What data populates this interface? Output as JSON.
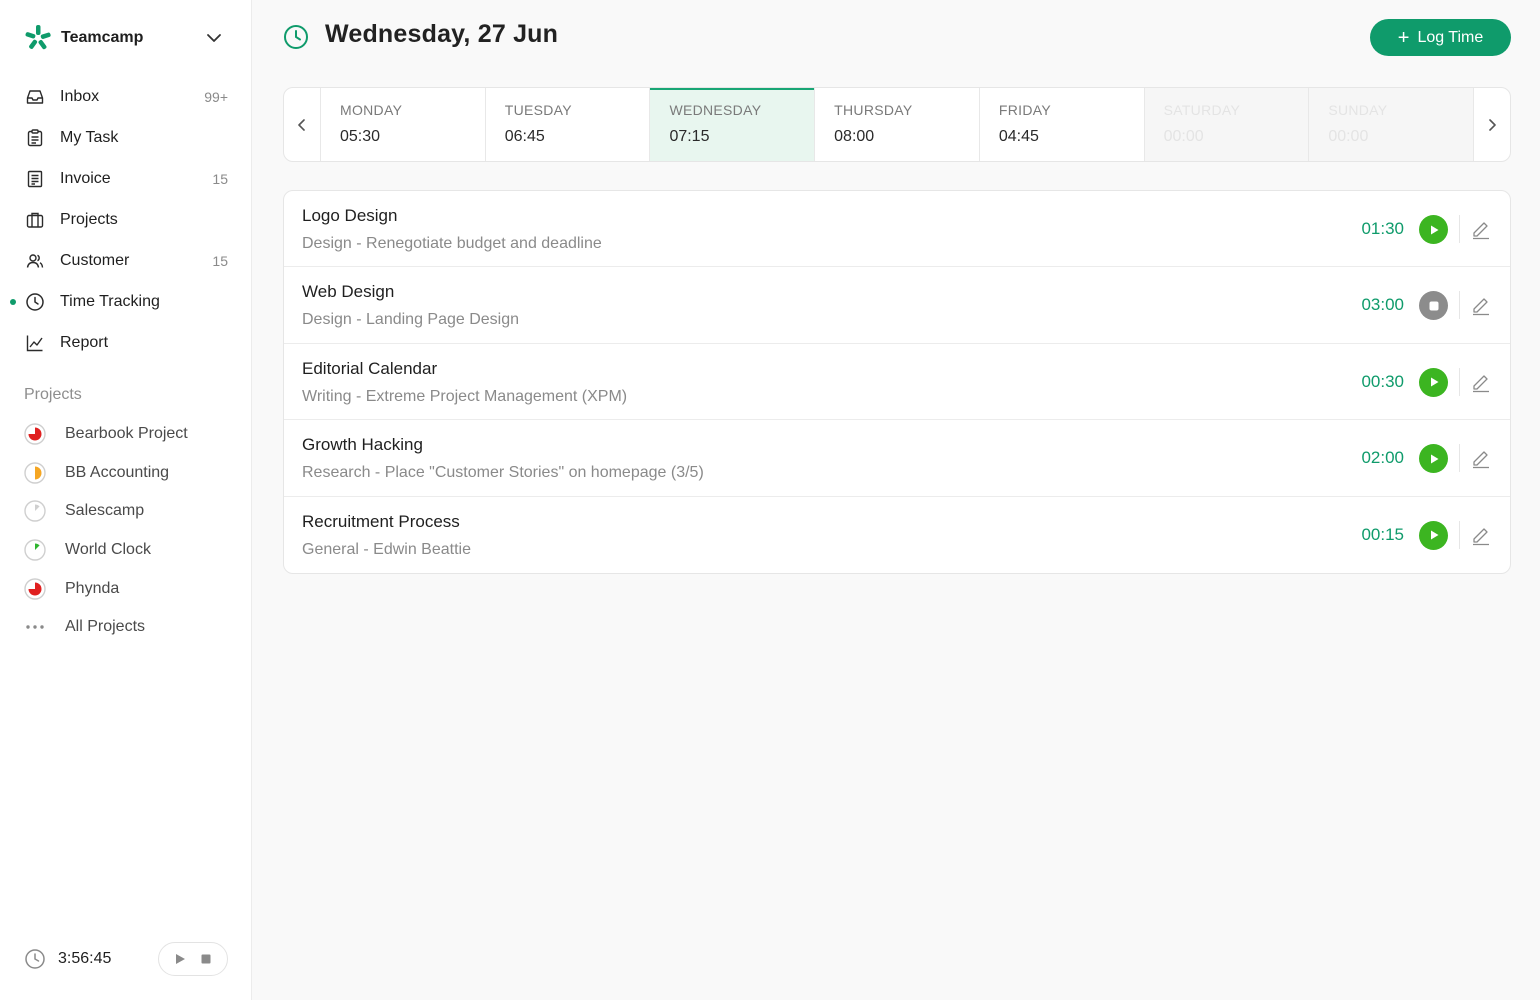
{
  "sidebar": {
    "brand": {
      "name": "Teamcamp"
    },
    "nav": [
      {
        "label": "Inbox",
        "count": "99+"
      },
      {
        "label": "My Task",
        "count": ""
      },
      {
        "label": "Invoice",
        "count": "15"
      },
      {
        "label": "Projects",
        "count": ""
      },
      {
        "label": "Customer",
        "count": "15"
      },
      {
        "label": "Time Tracking",
        "count": ""
      },
      {
        "label": "Report",
        "count": ""
      }
    ],
    "projects_heading": "Projects",
    "projects": [
      {
        "label": "Bearbook Project",
        "color": "#e02020",
        "progress": 0.75
      },
      {
        "label": "BB Accounting",
        "color": "#f5a623",
        "progress": 0.5
      },
      {
        "label": "Salescamp",
        "color": "#cfcfcf",
        "progress": 0.125
      },
      {
        "label": "World Clock",
        "color": "#2fb52f",
        "progress": 0.125
      },
      {
        "label": "Phynda",
        "color": "#e02020",
        "progress": 0.75
      },
      {
        "label": "All Projects"
      }
    ],
    "timer": {
      "time": "3:56:45"
    }
  },
  "header": {
    "title": "Wednesday, 27 Jun",
    "log_time_label": "Log Time"
  },
  "week": [
    {
      "name": "MONDAY",
      "time": "05:30"
    },
    {
      "name": "TUESDAY",
      "time": "06:45"
    },
    {
      "name": "WEDNESDAY",
      "time": "07:15"
    },
    {
      "name": "THURSDAY",
      "time": "08:00"
    },
    {
      "name": "FRIDAY",
      "time": "04:45"
    },
    {
      "name": "SATURDAY",
      "time": "00:00"
    },
    {
      "name": "SUNDAY",
      "time": "00:00"
    }
  ],
  "entries": [
    {
      "title": "Logo Design",
      "subtitle": "Design - Renegotiate budget and deadline",
      "duration": "01:30",
      "state": "play"
    },
    {
      "title": "Web Design",
      "subtitle": "Design - Landing Page Design",
      "duration": "03:00",
      "state": "stop"
    },
    {
      "title": "Editorial Calendar",
      "subtitle": "Writing - Extreme Project Management (XPM)",
      "duration": "00:30",
      "state": "play"
    },
    {
      "title": "Growth Hacking",
      "subtitle": "Research - Place \"Customer Stories\" on homepage (3/5)",
      "duration": "02:00",
      "state": "play"
    },
    {
      "title": "Recruitment Process",
      "subtitle": "General - Edwin Beattie",
      "duration": "00:15",
      "state": "play"
    }
  ],
  "colors": {
    "accent": "#0f9b6b",
    "play": "#3cb521",
    "stop": "#8c8c8c",
    "active_day_bg": "#e8f6ef"
  }
}
